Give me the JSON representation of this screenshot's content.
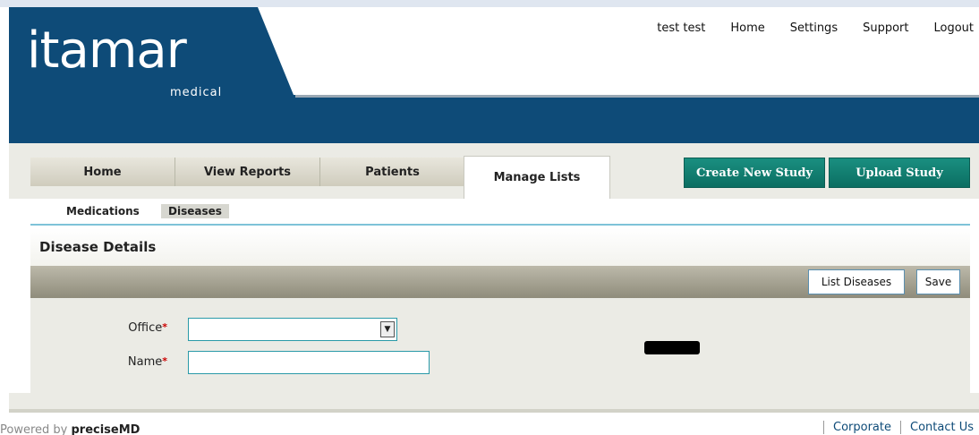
{
  "brand": {
    "logo": "itamar",
    "sub": "medical"
  },
  "topnav": [
    "test test",
    "Home",
    "Settings",
    "Support",
    "Logout"
  ],
  "tabs": [
    "Home",
    "View Reports",
    "Patients",
    "Manage Lists"
  ],
  "active_tab": "Manage Lists",
  "actions": {
    "create": "Create New Study",
    "upload": "Upload Study"
  },
  "subnav": [
    "Medications",
    "Diseases"
  ],
  "active_subnav": "Diseases",
  "page_title": "Disease Details",
  "toolbar": {
    "list": "List Diseases",
    "save": "Save"
  },
  "form": {
    "office_label": "Office",
    "name_label": "Name",
    "required_mark": "*",
    "office_value": "",
    "name_value": ""
  },
  "footer": {
    "powered_prefix": "Powered by ",
    "powered_brand": "preciseMD",
    "links": [
      "Corporate",
      "Contact Us"
    ]
  },
  "colors": {
    "header": "#0e4b78",
    "green": "#0b6e62",
    "accent_line": "#7ec3d8"
  }
}
